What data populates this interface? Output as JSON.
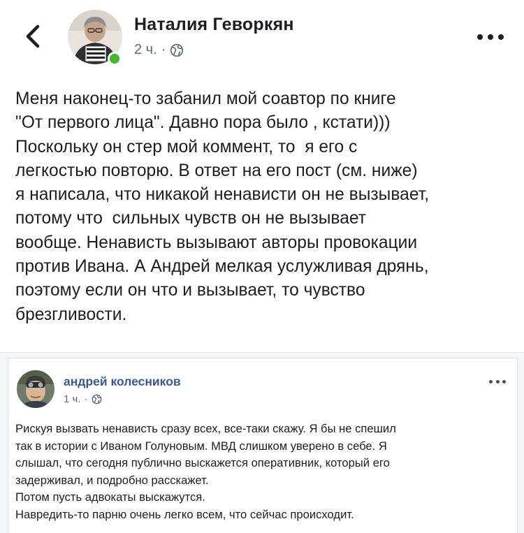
{
  "header": {
    "author_name": "Наталия Геворкян",
    "time": "2 ч.",
    "separator": "·",
    "avatar_sign_text": "Свободу Ивану Голунову",
    "privacy_icon": "globe-icon",
    "back_icon": "chevron-left-icon",
    "more_icon": "more-horizontal-icon",
    "online_color": "#42b72a"
  },
  "post": {
    "lines": [
      "Меня наконец-то забанил мой соавтор по книге",
      "\"От первого лица\". Давно пора было , кстати)))",
      "Поскольку он стер мой коммент, то  я его с",
      "легкостью повторю. В ответ на его пост (см. ниже)",
      "я написала, что никакой ненависти он не вызывает,",
      "потому что  сильных чувств он не вызывает",
      "вообще. Ненависть вызывают авторы провокации",
      "против Ивана. А Андрей мелкая услужливая дрянь,",
      "поэтому если он что и вызывает, то чувство",
      "брезгливости."
    ]
  },
  "shared_post": {
    "author_name": "андрей колесников",
    "time": "1 ч.",
    "separator": "·",
    "name_color": "#385898",
    "lines": [
      "Рискуя вызвать ненависть сразу всех, все-таки скажу. Я бы не спешил",
      "так в истории с Иваном Голуновым. МВД слишком уверено в себе. Я",
      "слышал, что сегодня публично выскажется оперативник, который его",
      "задерживал, и подробно расскажет.",
      "Потом пусть адвокаты выскажутся.",
      "Навредить-то парню очень легко всем, что сейчас происходит."
    ]
  }
}
